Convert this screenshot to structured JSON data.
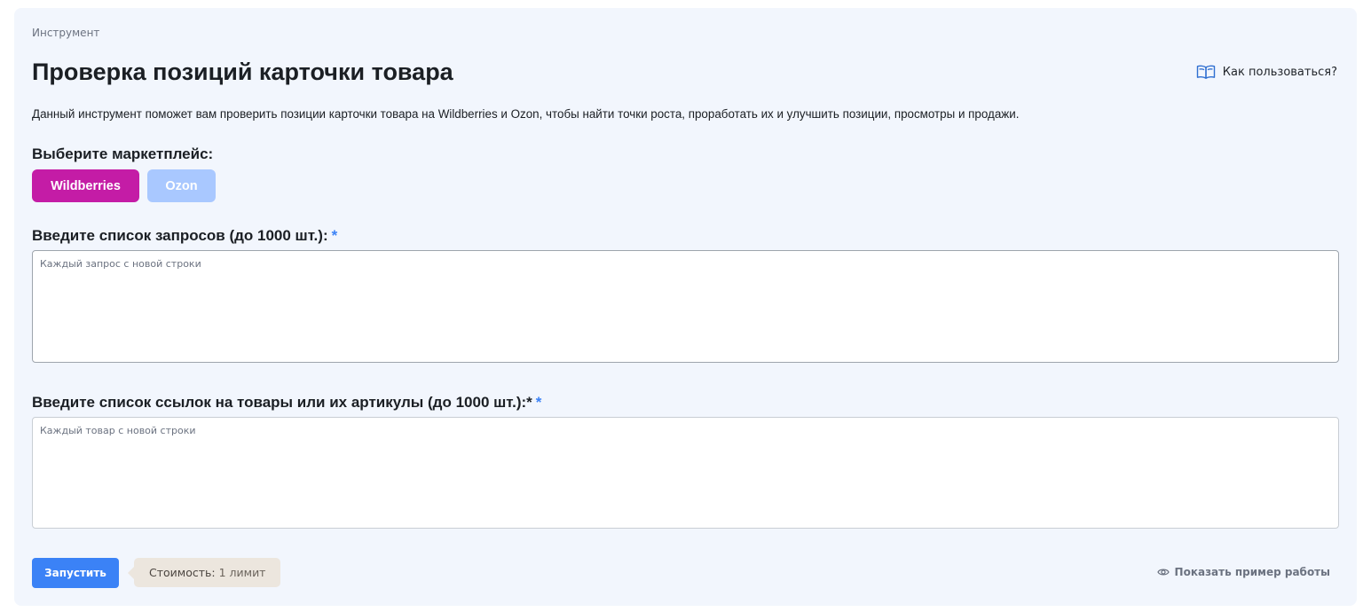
{
  "breadcrumb": "Инструмент",
  "page_title": "Проверка позиций карточки товара",
  "help_link": {
    "label": "Как пользоваться?",
    "icon": "book-icon"
  },
  "description": "Данный инструмент поможет вам проверить позиции карточки товара на Wildberries и Ozon, чтобы найти точки роста, проработать их и улучшить позиции, просмотры и продажи.",
  "marketplace": {
    "label": "Выберите маркетплейс:",
    "options": [
      {
        "label": "Wildberries",
        "selected": true,
        "color": "#c41ca6"
      },
      {
        "label": "Ozon",
        "selected": false,
        "color": "#a9c8ff"
      }
    ]
  },
  "queries": {
    "label": "Введите список запросов (до 1000 шт.):",
    "required_mark": "*",
    "placeholder": "Каждый запрос с новой строки",
    "value": ""
  },
  "products": {
    "label": "Введите список ссылок на товары или их артикулы (до 1000 шт.):*",
    "required_mark": "*",
    "placeholder": "Каждый товар с новой строки",
    "value": ""
  },
  "footer": {
    "run_label": "Запустить",
    "cost_key": "Стоимость:",
    "cost_value": "1 лимит",
    "example_label": "Показать пример работы",
    "example_icon": "eye-icon"
  },
  "colors": {
    "accent": "#3b82f6",
    "card_bg": "#f2f6fd"
  }
}
